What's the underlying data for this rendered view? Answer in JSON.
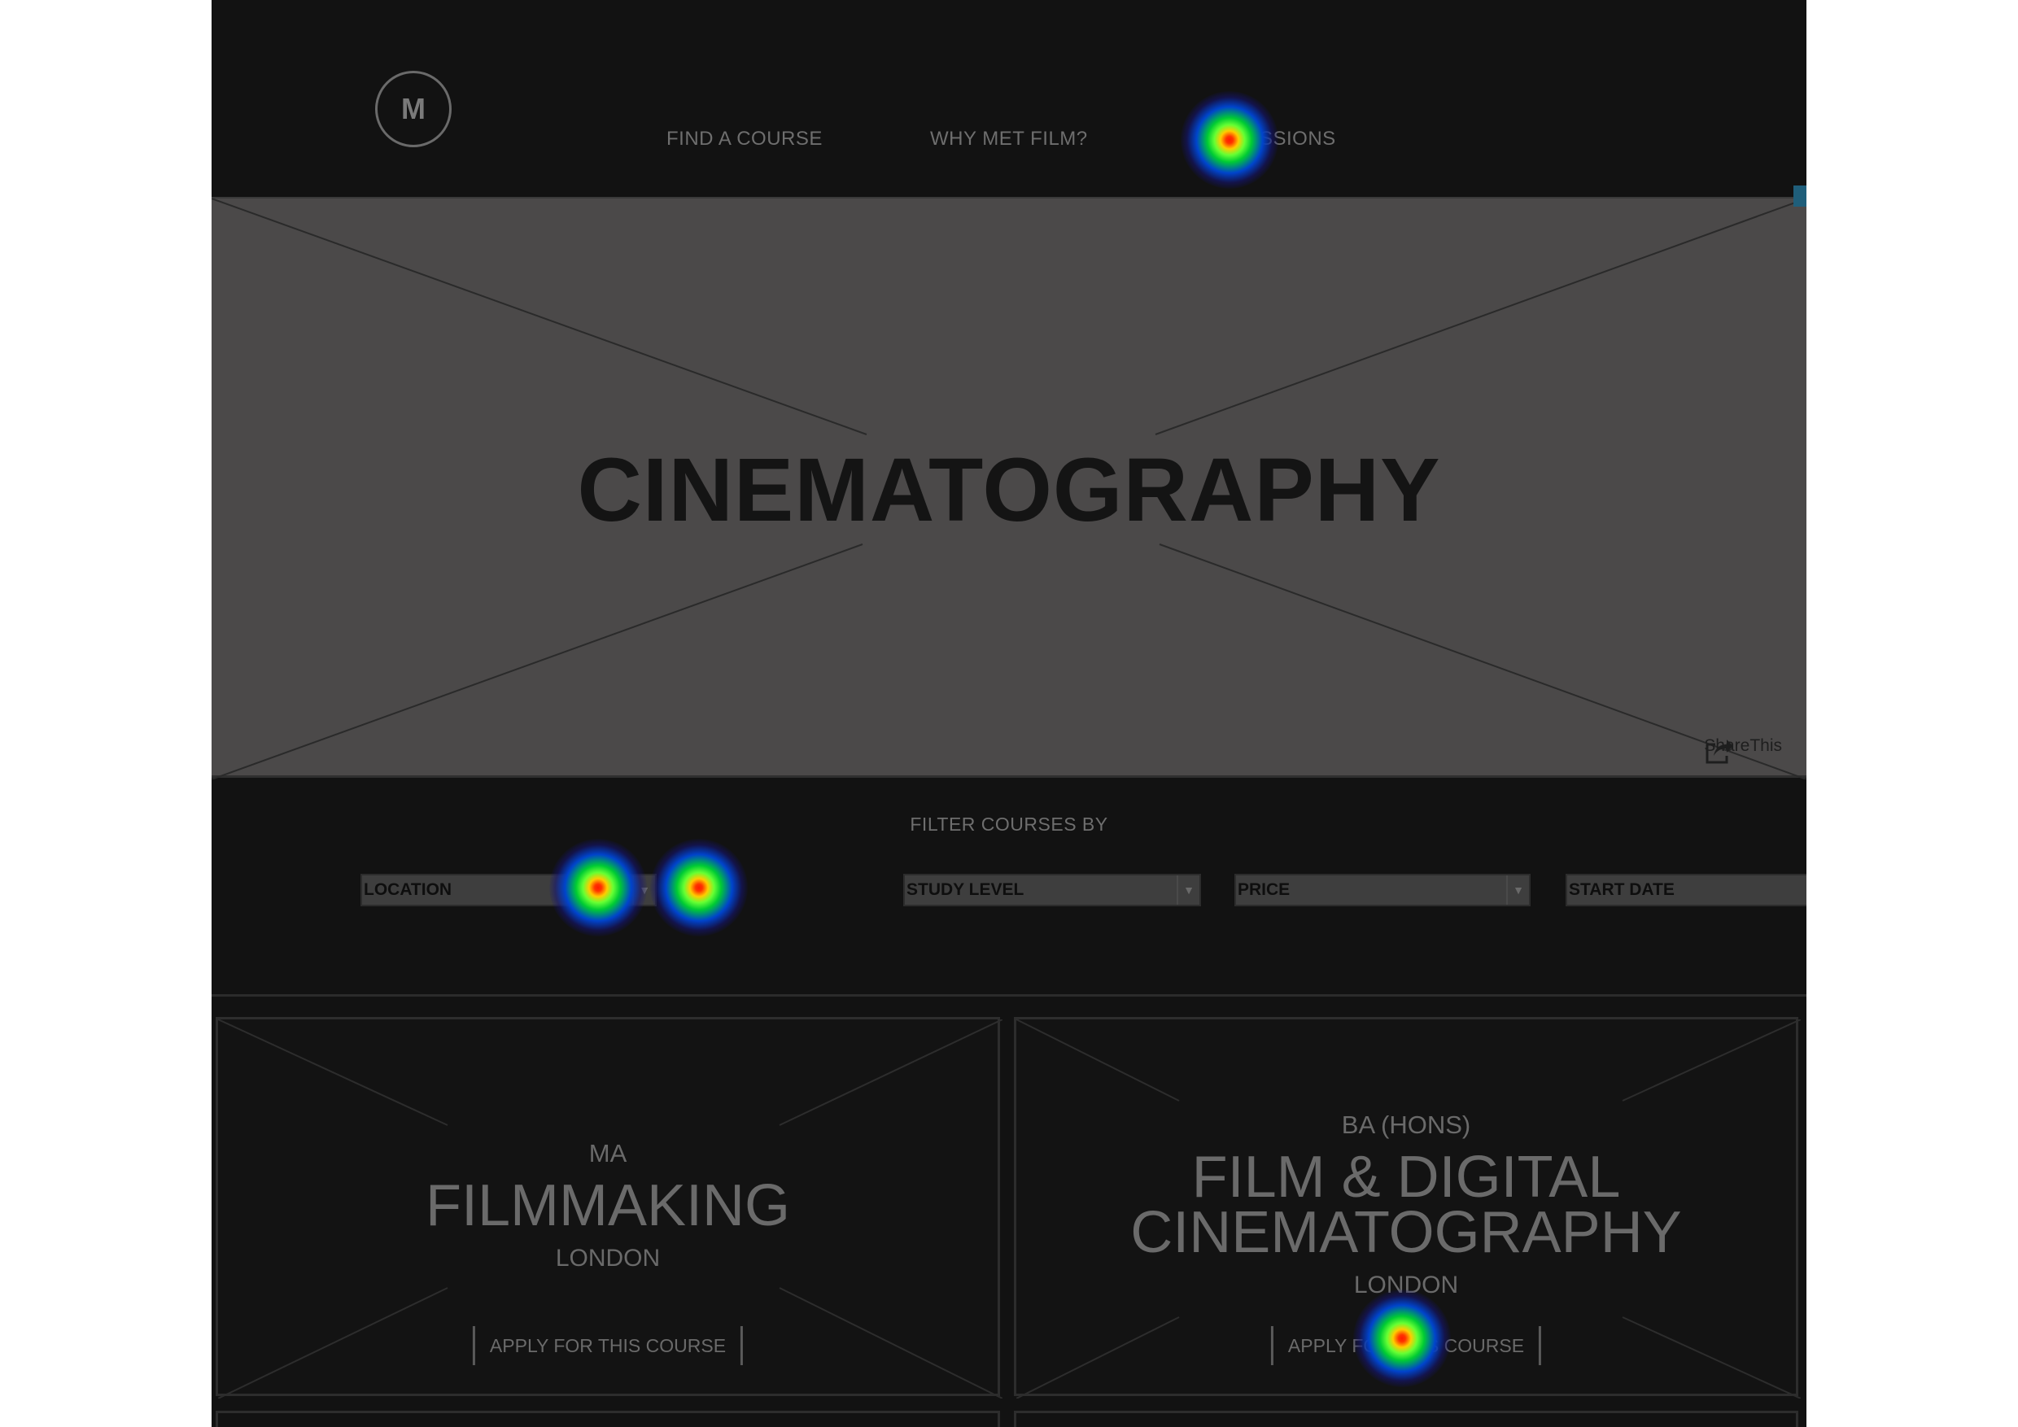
{
  "header": {
    "logo_text": "M",
    "nav": [
      "FIND A COURSE",
      "WHY MET FILM?",
      "ADMISSIONS"
    ]
  },
  "hero": {
    "title": "CINEMATOGRAPHY",
    "share_label": "ShareThis"
  },
  "filter": {
    "title": "FILTER COURSES BY",
    "selects": [
      "LOCATION",
      "STUDY LEVEL",
      "PRICE",
      "START DATE"
    ]
  },
  "courses": [
    {
      "level": "MA",
      "name_lines": [
        "FILMMAKING"
      ],
      "location": "LONDON",
      "apply_label": "APPLY FOR THIS COURSE"
    },
    {
      "level": "BA (HONS)",
      "name_lines": [
        "FILM & DIGITAL",
        "CINEMATOGRAPHY"
      ],
      "location": "LONDON",
      "apply_label": "APPLY FOR THIS COURSE"
    }
  ],
  "overlay": {
    "type": "attention heatmap",
    "colors": [
      "#ff1a00",
      "#ffcc00",
      "#66ff33",
      "#0044cc"
    ]
  }
}
